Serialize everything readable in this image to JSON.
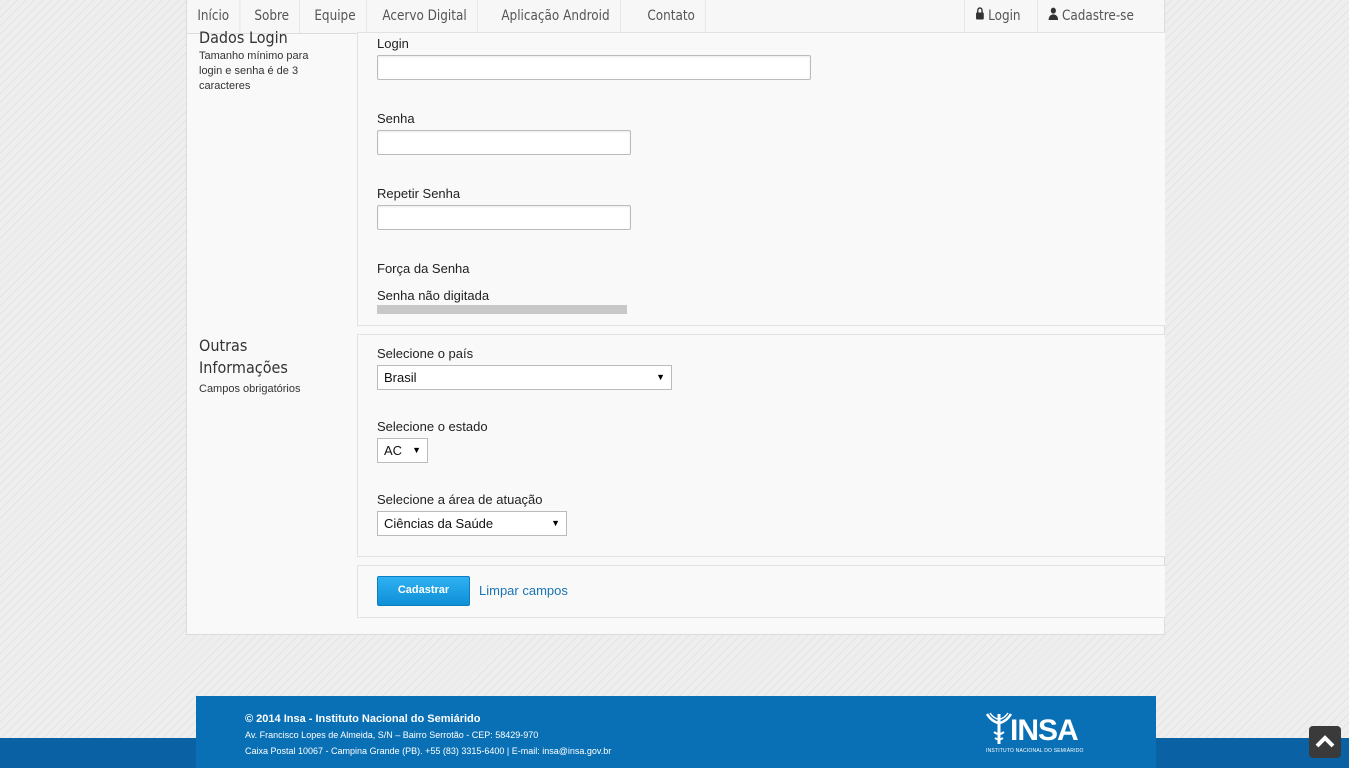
{
  "nav": {
    "left": [
      "Início",
      "Sobre",
      "Equipe",
      "Acervo Digital",
      "Aplicação Android",
      "Contato"
    ],
    "login": "Login",
    "register": "Cadastre-se",
    "login_icon": "lock-icon",
    "register_icon": "user-icon"
  },
  "login_section": {
    "title": "Dados Login",
    "desc": "Tamanho mínimo para login e senha é de 3 caracteres",
    "login_label": "Login",
    "login_value": "",
    "password_label": "Senha",
    "password_value": "",
    "repeat_label": "Repetir Senha",
    "repeat_value": "",
    "strength_label": "Força da Senha",
    "strength_status": "Senha não digitada"
  },
  "other_section": {
    "title": "Outras Informações",
    "desc": "Campos obrigatórios",
    "country_label": "Selecione o país",
    "country_value": "Brasil",
    "state_label": "Selecione o estado",
    "state_value": "AC",
    "area_label": "Selecione a área de atuação",
    "area_value": "Ciências da Saúde"
  },
  "actions": {
    "submit": "Cadastrar",
    "clear": "Limpar campos"
  },
  "footer": {
    "title": "© 2014 Insa - Instituto Nacional do Semiárido",
    "line1": "Av. Francisco Lopes de Almeida, S/N – Bairro Serrotão - CEP: 58429-970",
    "line2": "Caixa Postal 10067 - Campina Grande (PB). +55 (83) 3315-6400 | E-mail: insa@insa.gov.br",
    "logo_text": "INSA",
    "logo_sub": "INSTITUTO NACIONAL DO SEMIÁRIDO"
  },
  "colors": {
    "accent": "#0a70b5",
    "button": "#1a9de6",
    "link": "#1a73b5"
  }
}
